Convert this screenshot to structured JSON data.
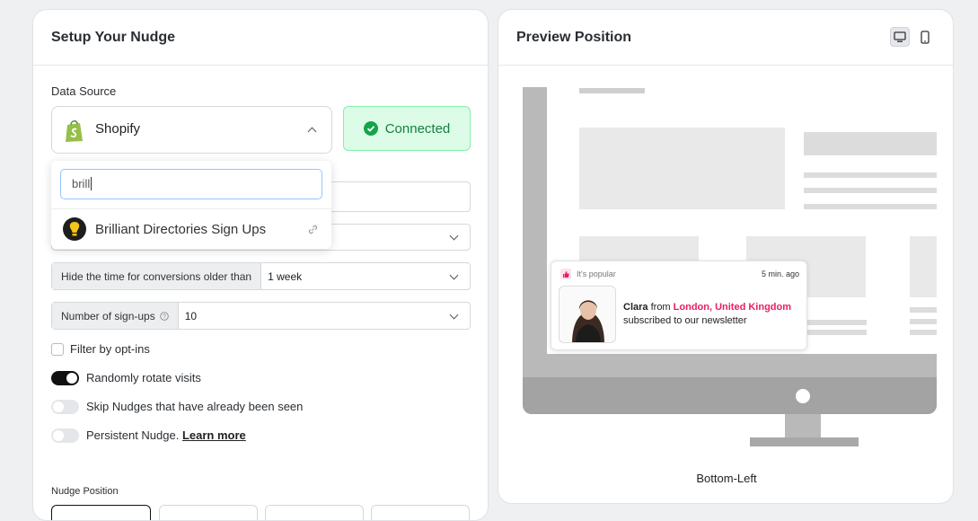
{
  "left": {
    "title": "Setup Your Nudge",
    "data_source_label": "Data Source",
    "source": {
      "name": "Shopify",
      "icon": "shopify-icon"
    },
    "status": {
      "label": "Connected",
      "color": "#16a34a",
      "bg": "#dcfce7"
    },
    "dropdown": {
      "search_value": "brill",
      "results": [
        {
          "label": "Brilliant Directories Sign Ups",
          "icon": "brilliant-directories-icon"
        }
      ]
    },
    "hide_time": {
      "label": "Hide the time for conversions older than",
      "value": "1 week"
    },
    "signups": {
      "label": "Number of sign-ups",
      "value": "10"
    },
    "filter_optins": {
      "label": "Filter by opt-ins",
      "checked": false
    },
    "toggles": [
      {
        "label": "Randomly rotate visits",
        "on": true
      },
      {
        "label": "Skip Nudges that have already been seen",
        "on": false
      },
      {
        "label": "Persistent Nudge.",
        "link": "Learn more",
        "on": false
      }
    ],
    "position_label": "Nudge Position"
  },
  "right": {
    "title": "Preview Position",
    "devices": [
      "desktop-icon",
      "mobile-icon"
    ],
    "nudge": {
      "tag": "It's popular",
      "time": "5 min. ago",
      "name": "Clara",
      "from": "from",
      "location": "London, United Kingdom",
      "action": "subscribed to our newsletter"
    },
    "position": "Bottom-Left"
  },
  "colors": {
    "accent_pink": "#e91e63",
    "toggle_on": "#111111",
    "toggle_off": "#e4e6e9"
  }
}
